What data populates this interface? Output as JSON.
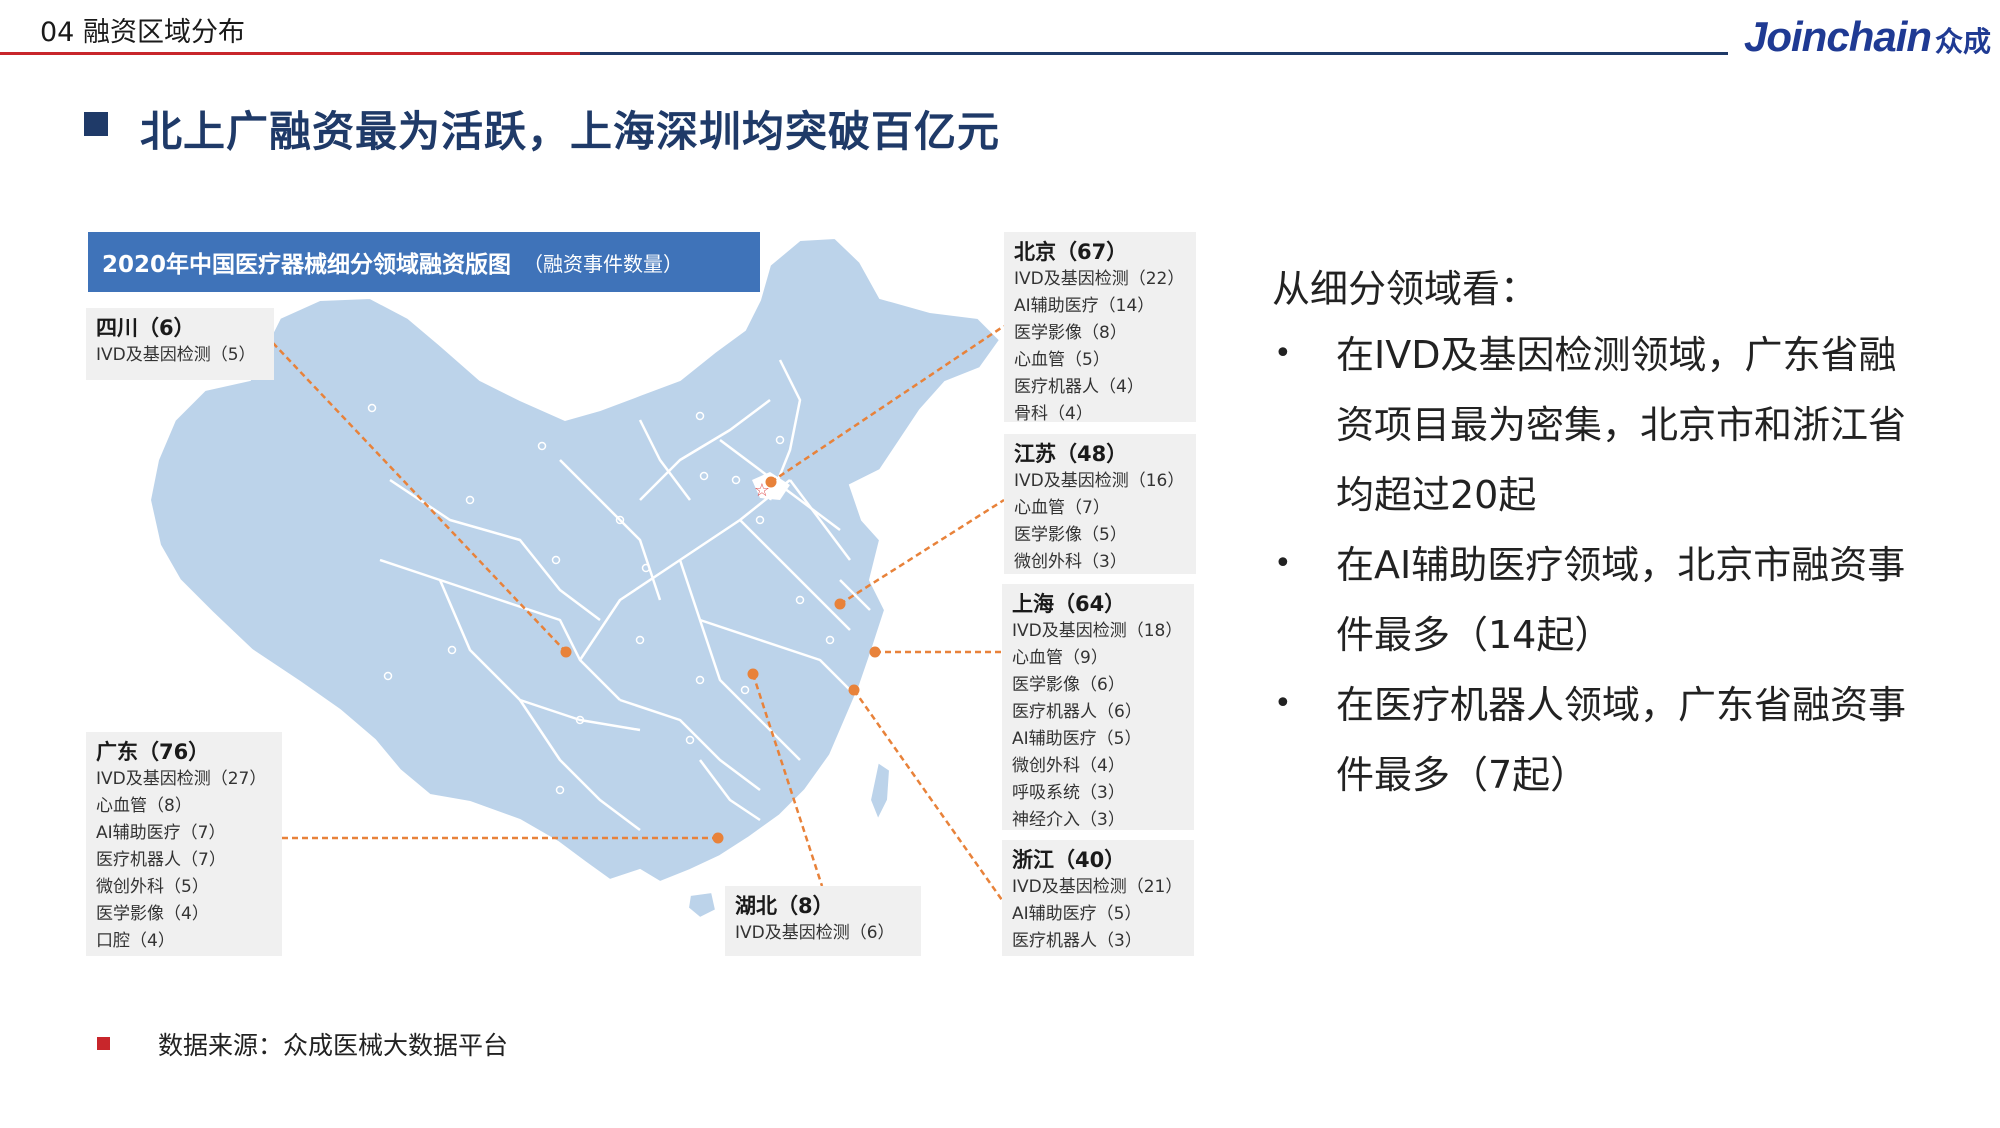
{
  "header": {
    "section_title": "04 融资区域分布",
    "logo_text": "Joinchain",
    "logo_cn": "众成"
  },
  "main_heading": "北上广融资最为活跃，上海深圳均突破百亿元",
  "map": {
    "title_main": "2020年中国医疗器械细分领域融资版图",
    "title_sub": "（融资事件数量）",
    "land_color": "#bcd3ea",
    "border_color": "#ffffff",
    "leader_color": "#e8823a",
    "regions": {
      "sichuan": {
        "name": "四川（6）",
        "items": [
          "IVD及基因检测（5）"
        ]
      },
      "guangdong": {
        "name": "广东（76）",
        "items": [
          "IVD及基因检测（27）",
          "心血管（8）",
          "AI辅助医疗（7）",
          "医疗机器人（7）",
          "微创外科（5）",
          "医学影像（4）",
          "口腔（4）"
        ]
      },
      "hubei": {
        "name": "湖北（8）",
        "items": [
          "IVD及基因检测（6）"
        ]
      },
      "beijing": {
        "name": "北京（67）",
        "items": [
          "IVD及基因检测（22）",
          "AI辅助医疗（14）",
          "医学影像（8）",
          "心血管（5）",
          "医疗机器人（4）",
          "骨科（4）"
        ]
      },
      "jiangsu": {
        "name": "江苏（48）",
        "items": [
          "IVD及基因检测（16）",
          "心血管（7）",
          "医学影像（5）",
          "微创外科（3）"
        ]
      },
      "shanghai": {
        "name": "上海（64）",
        "items": [
          "IVD及基因检测（18）",
          "心血管（9）",
          "医学影像（6）",
          "医疗机器人（6）",
          "AI辅助医疗（5）",
          "微创外科（4）",
          "呼吸系统（3）",
          "神经介入（3）"
        ]
      },
      "zhejiang": {
        "name": "浙江（40）",
        "items": [
          "IVD及基因检测（21）",
          "AI辅助医疗（5）",
          "医疗机器人（3）"
        ]
      }
    }
  },
  "analysis": {
    "title": "从细分领域看：",
    "bullet_glyph": "•",
    "points": [
      "在IVD及基因检测领域，广东省融资项目最为密集，北京市和浙江省均超过20起",
      "在AI辅助医疗领域，北京市融资事件最多（14起）",
      "在医疗机器人领域，广东省融资事件最多（7起）"
    ]
  },
  "source": "数据来源：众成医械大数据平台",
  "colors": {
    "accent_red": "#c8262b",
    "navy": "#1f3a68",
    "map_title_bg": "#3f73b9"
  }
}
